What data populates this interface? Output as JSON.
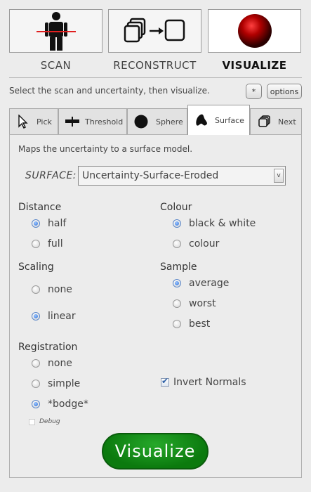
{
  "steps": [
    {
      "label": "SCAN",
      "icon": "person-scan-icon",
      "active": false
    },
    {
      "label": "RECONSTRUCT",
      "icon": "reconstruct-icon",
      "active": false
    },
    {
      "label": "VISUALIZE",
      "icon": "red-sphere-icon",
      "active": true
    }
  ],
  "instruction": "Select the scan and uncertainty, then visualize.",
  "buttons": {
    "star": "*",
    "options": "options",
    "visualize": "Visualize"
  },
  "tabs": [
    {
      "label": "Pick",
      "icon": "cursor-arrow-icon",
      "active": false
    },
    {
      "label": "Threshold",
      "icon": "threshold-icon",
      "active": false
    },
    {
      "label": "Sphere",
      "icon": "black-circle-icon",
      "active": false
    },
    {
      "label": "Surface",
      "icon": "surface-blob-icon",
      "active": true
    },
    {
      "label": "Next",
      "icon": "stacked-squares-icon",
      "active": false
    }
  ],
  "panel": {
    "description": "Maps the uncertainty to a surface model.",
    "surface_label": "SURFACE:",
    "surface_selected": "Uncertainty-Surface-Eroded",
    "select_arrow": "v"
  },
  "groups": {
    "distance": {
      "title": "Distance",
      "options": [
        "half",
        "full"
      ],
      "selected": "half"
    },
    "colour": {
      "title": "Colour",
      "options": [
        "black & white",
        "colour"
      ],
      "selected": "black & white"
    },
    "scaling": {
      "title": "Scaling",
      "options": [
        "none",
        "linear"
      ],
      "selected": "linear"
    },
    "sample": {
      "title": "Sample",
      "options": [
        "average",
        "worst",
        "best"
      ],
      "selected": "average"
    },
    "registration": {
      "title": "Registration",
      "options": [
        "none",
        "simple",
        "*bodge*"
      ],
      "selected": "*bodge*"
    }
  },
  "invert_normals": {
    "label": "Invert Normals",
    "checked": true
  },
  "debug": {
    "label": "Debug",
    "checked": false
  },
  "colors": {
    "accent_green": "#138a17",
    "sphere_red": "#b00000"
  }
}
